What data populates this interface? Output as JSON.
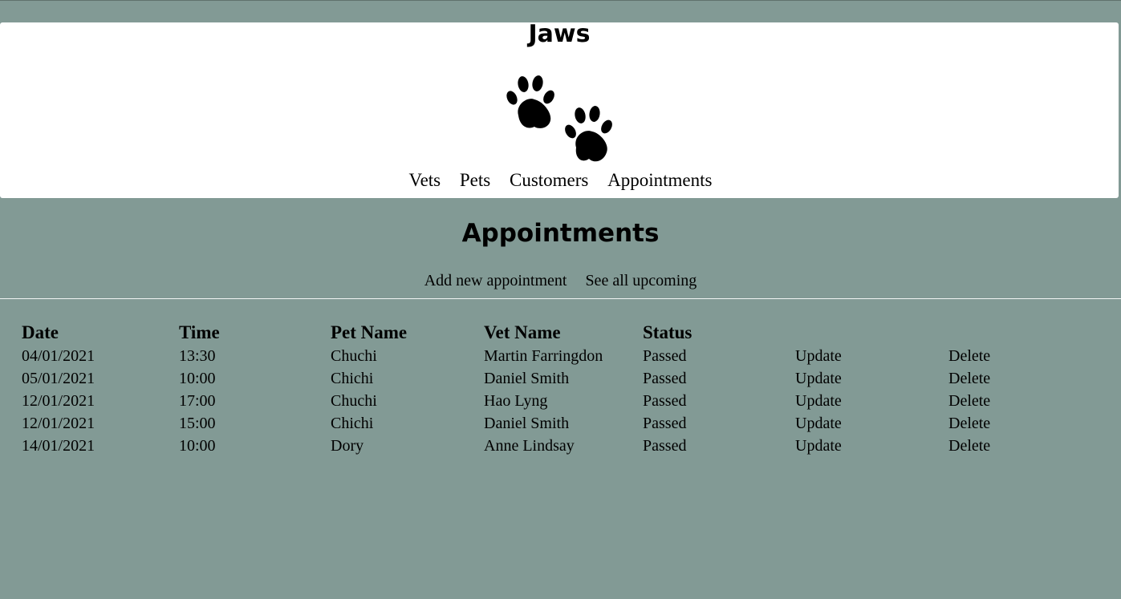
{
  "site": {
    "title": "Jaws"
  },
  "nav": {
    "items": [
      "Vets",
      "Pets",
      "Customers",
      "Appointments"
    ]
  },
  "page": {
    "title": "Appointments",
    "add_link": "Add new appointment",
    "upcoming_link": "See all upcoming"
  },
  "table": {
    "headers": [
      "Date",
      "Time",
      "Pet Name",
      "Vet Name",
      "Status",
      "",
      ""
    ],
    "rows": [
      {
        "date": "04/01/2021",
        "time": "13:30",
        "pet": "Chuchi",
        "vet": "Martin Farringdon",
        "status": "Passed",
        "update": "Update",
        "delete": "Delete"
      },
      {
        "date": "05/01/2021",
        "time": "10:00",
        "pet": "Chichi",
        "vet": "Daniel Smith",
        "status": "Passed",
        "update": "Update",
        "delete": "Delete"
      },
      {
        "date": "12/01/2021",
        "time": "17:00",
        "pet": "Chuchi",
        "vet": "Hao Lyng",
        "status": "Passed",
        "update": "Update",
        "delete": "Delete"
      },
      {
        "date": "12/01/2021",
        "time": "15:00",
        "pet": "Chichi",
        "vet": "Daniel Smith",
        "status": "Passed",
        "update": "Update",
        "delete": "Delete"
      },
      {
        "date": "14/01/2021",
        "time": "10:00",
        "pet": "Dory",
        "vet": "Anne Lindsay",
        "status": "Passed",
        "update": "Update",
        "delete": "Delete"
      }
    ]
  },
  "colors": {
    "background": "#829a95",
    "header_bg": "#ffffff",
    "text": "#000000"
  },
  "icons": {
    "logo": "paw-prints-icon"
  }
}
